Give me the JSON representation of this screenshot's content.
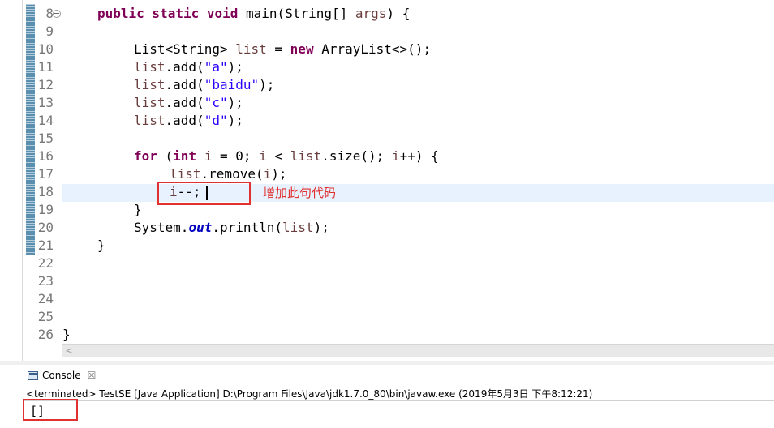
{
  "editor": {
    "line_numbers": [
      "8",
      "9",
      "10",
      "11",
      "12",
      "13",
      "14",
      "15",
      "16",
      "17",
      "18",
      "19",
      "20",
      "21",
      "22",
      "23",
      "24",
      "25",
      "26"
    ],
    "code": {
      "l8_kw": "public static void",
      "l8_rest": " main(String[] ",
      "l8_args": "args",
      "l8_end": ") {",
      "l10_type": "List<String> ",
      "l10_var": "list",
      "l10_eq": " = ",
      "l10_new": "new",
      "l10_rest": " ArrayList<>();",
      "l11_var": "list",
      "l11_call": ".add(",
      "l11_str": "\"a\"",
      "l11_end": ");",
      "l12_var": "list",
      "l12_call": ".add(",
      "l12_str": "\"baidu\"",
      "l12_end": ");",
      "l13_var": "list",
      "l13_call": ".add(",
      "l13_str": "\"c\"",
      "l13_end": ");",
      "l14_var": "list",
      "l14_call": ".add(",
      "l14_str": "\"d\"",
      "l14_end": ");",
      "l16_for": "for",
      "l16_p1": " (",
      "l16_int": "int",
      "l16_sp": " ",
      "l16_i1": "i",
      "l16_eq": " = 0; ",
      "l16_i2": "i",
      "l16_lt": " < ",
      "l16_list": "list",
      "l16_size": ".size(); ",
      "l16_i3": "i",
      "l16_end": "++) {",
      "l17_var": "list",
      "l17_call": ".remove(",
      "l17_i": "i",
      "l17_end": ");",
      "l18_i": "i",
      "l18_end": "--;",
      "l19": "}",
      "l20_sys": "System.",
      "l20_out": "out",
      "l20_call": ".println(",
      "l20_var": "list",
      "l20_end": ");",
      "l21": "}",
      "l26": "}"
    },
    "annotation": "增加此句代码",
    "scroll_left_arrow": "<"
  },
  "console": {
    "tab_label": "Console",
    "tab_close": "☒",
    "status": "<terminated> TestSE [Java Application] D:\\Program Files\\Java\\jdk1.7.0_80\\bin\\javaw.exe (2019年5月3日 下午8:12:21)",
    "output": "[]"
  },
  "colors": {
    "keyword": "#7f0055",
    "string": "#2a00ff",
    "local_variable": "#6a3e3e",
    "static_field": "#0000c0",
    "annotation_red": "#e03030",
    "current_line": "#e8f2fe"
  }
}
